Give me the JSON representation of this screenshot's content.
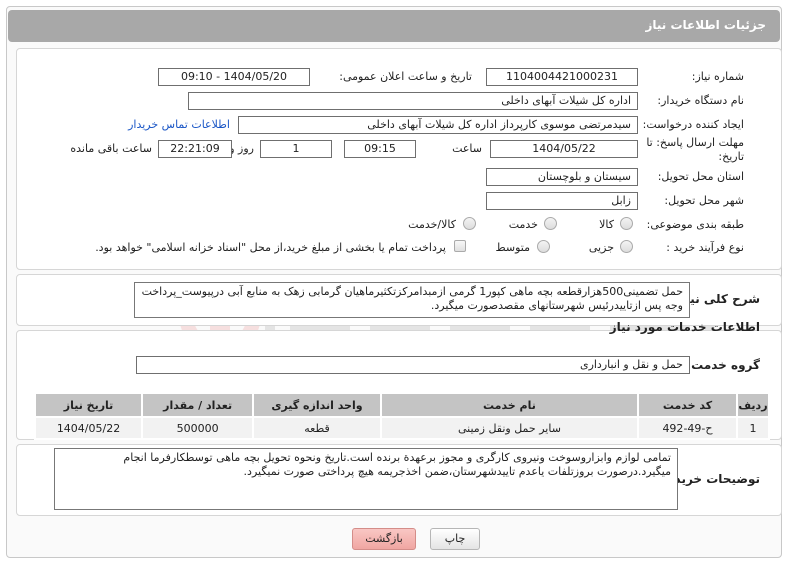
{
  "header": {
    "title": "جزئیات اطلاعات نیاز"
  },
  "fields": {
    "need_number_label": "شماره نیاز:",
    "need_number": "1104004421000231",
    "announce_label": "تاریخ و ساعت اعلان عمومی:",
    "announce_value": "1404/05/20 - 09:10",
    "buyer_org_label": "نام دستگاه خریدار:",
    "buyer_org": "اداره کل شیلات آبهای داخلی",
    "creator_label": "ایجاد کننده درخواست:",
    "creator": "سیدمرتضی موسوی کارپرداز اداره کل شیلات آبهای داخلی",
    "contact_link": "اطلاعات تماس خریدار",
    "deadline_label": "مهلت ارسال پاسخ: تا تاریخ:",
    "deadline_date": "1404/05/22",
    "time_label": "ساعت",
    "deadline_time": "09:15",
    "days_value": "1",
    "days_label": "روز و",
    "remaining_time": "22:21:09",
    "remaining_label": "ساعت باقی مانده",
    "province_label": "استان محل تحویل:",
    "province": "سیستان و بلوچستان",
    "city_label": "شهر محل تحویل:",
    "city": "زابل",
    "category_label": "طبقه بندی موضوعی:",
    "category_options": [
      "کالا",
      "خدمت",
      "کالا/خدمت"
    ],
    "process_label": "نوع فرآیند خرید :",
    "process_options": [
      "جزیی",
      "متوسط"
    ],
    "payment_note": "پرداخت تمام یا بخشی از مبلغ خرید،از محل \"اسناد خزانه اسلامی\" خواهد بود."
  },
  "description": {
    "label": "شرح کلی نیاز:",
    "text": "حمل تضمینی500هزارقطعه بچه ماهی کپور1 گرمی ازمبدامرکزتکثیرماهیان گرمابی زهک به منابع آبی درپیوست_پرداخت وجه پس ازتاییدرئیس شهرستانهای مقصدصورت میگیرد."
  },
  "services": {
    "section_title": "اطلاعات خدمات مورد نیاز",
    "group_label": "گروه خدمت:",
    "group_value": "حمل و نقل و انبارداری",
    "columns": [
      "ردیف",
      "کد خدمت",
      "نام خدمت",
      "واحد اندازه گیری",
      "تعداد / مقدار",
      "تاریخ نیاز"
    ],
    "rows": [
      [
        "1",
        "ح-49-492",
        "سایر حمل ونقل زمینی",
        "قطعه",
        "500000",
        "1404/05/22"
      ]
    ]
  },
  "buyer_notes": {
    "label": "توضیحات خریدار:",
    "text": "تمامی لوازم وابزاروسوخت ونیروی کارگری و مجوز برعهدة برنده است.تاریخ ونحوه تحویل بچه ماهی توسطکارفرما انجام میگیرد.درصورت بروزتلفات یاعدم تاییدشهرستان،ضمن اخذجریمه هیچ پرداختی صورت نمیگیرد."
  },
  "buttons": {
    "print": "چاپ",
    "back": "بازگشت"
  },
  "colors": {
    "header_bg": "#a8a8a8",
    "link": "#1a56c6",
    "back_button": "#f0a6a2"
  }
}
